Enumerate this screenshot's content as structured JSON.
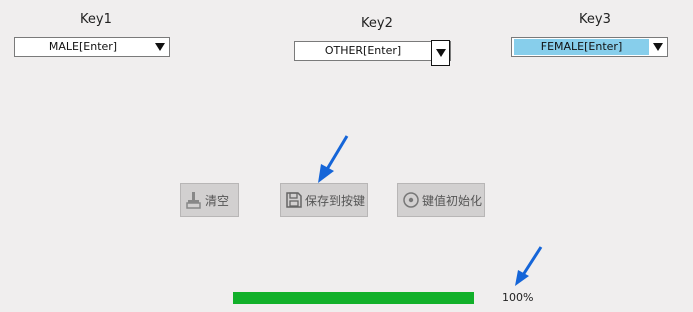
{
  "keys": [
    {
      "label": "Key1",
      "value": "MALE[Enter]"
    },
    {
      "label": "Key2",
      "value": "OTHER[Enter]"
    },
    {
      "label": "Key3",
      "value": "FEMALE[Enter]"
    }
  ],
  "buttons": {
    "clear": {
      "label": "清空",
      "icon": "broom-icon"
    },
    "save": {
      "label": "保存到按键",
      "icon": "floppy-disk-icon"
    },
    "reset": {
      "label": "键值初始化",
      "icon": "disc-reset-icon"
    }
  },
  "progress": {
    "value": 1.0,
    "text": "100%"
  },
  "colors": {
    "progress": "#12b02a",
    "selection": "#87ceeb",
    "arrow": "#1565d8"
  }
}
